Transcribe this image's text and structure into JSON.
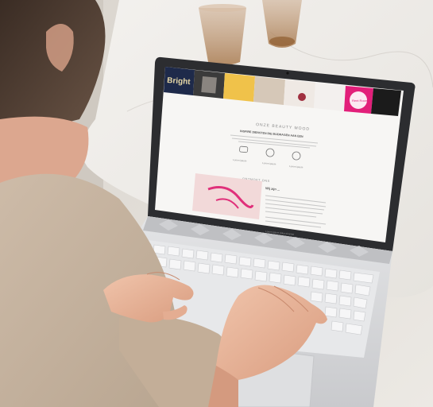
{
  "scene": {
    "description_colors": {
      "background_floor": "#e6e2dc",
      "table_marble": "#f1efec",
      "laptop_silver": "#d9dadc",
      "laptop_bezel": "#2c2d30",
      "skin": "#e9b9a0",
      "sweater": "#c9b6a3",
      "brand_accent": "#e21f7a"
    }
  },
  "screen": {
    "banner_word": "Bright",
    "pink_logo_text": "Rent Room",
    "section_title": "ONZE BEAUTY MOOD",
    "section_subtitle": "INSPIRE DIENSTEN DIE BIJDRAGEN AAN EEN",
    "feature_1": "Lorem ipsum",
    "feature_2": "Lorem ipsum",
    "feature_3": "Lorem ipsum",
    "lower_title": "ONTMOET ONS",
    "card_heading": "Wij zijn ...",
    "card_body": "Lorem ipsum dolor sit amet"
  }
}
